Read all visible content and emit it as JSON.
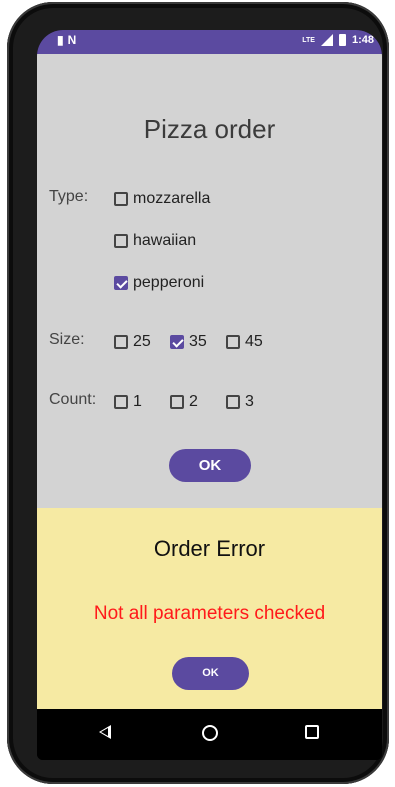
{
  "status_bar": {
    "left_icons": [
      "sim-icon",
      "n-icon"
    ],
    "network": "LTE",
    "time": "1:48"
  },
  "screen": {
    "title": "Pizza order",
    "type": {
      "label": "Type:",
      "options": [
        {
          "label": "mozzarella",
          "checked": false
        },
        {
          "label": "hawaiian",
          "checked": false
        },
        {
          "label": "pepperoni",
          "checked": true
        }
      ]
    },
    "size": {
      "label": "Size:",
      "options": [
        {
          "label": "25",
          "checked": false
        },
        {
          "label": "35",
          "checked": true
        },
        {
          "label": "45",
          "checked": false
        }
      ]
    },
    "count": {
      "label": "Count:",
      "options": [
        {
          "label": "1",
          "checked": false
        },
        {
          "label": "2",
          "checked": false
        },
        {
          "label": "3",
          "checked": false
        }
      ]
    },
    "ok_label": "OK"
  },
  "dialog": {
    "title": "Order Error",
    "message": "Not all parameters checked",
    "ok_label": "OK"
  },
  "colors": {
    "accent": "#5b4aa0",
    "dialog_bg": "#f6eaa3",
    "error_text": "#ff1a1a",
    "app_bg": "#d3d3d3"
  }
}
